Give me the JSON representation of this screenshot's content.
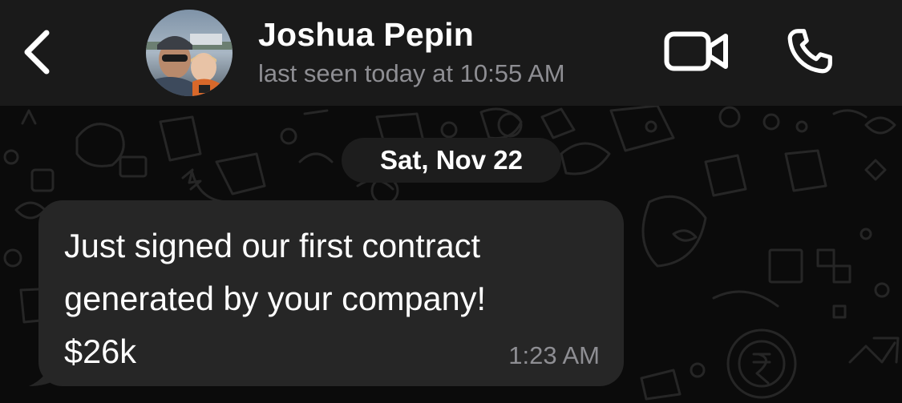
{
  "header": {
    "back_icon": "chevron-left-icon",
    "contact_name": "Joshua Pepin",
    "last_seen": "last seen today at 10:55 AM",
    "video_icon": "video-camera-icon",
    "call_icon": "phone-icon"
  },
  "chat": {
    "date_label": "Sat, Nov 22",
    "messages": [
      {
        "direction": "incoming",
        "text": "Just signed our first contract\ngenerated by your company!\n$26k",
        "time": "1:23 AM"
      }
    ]
  },
  "colors": {
    "header_bg": "#1a1a1a",
    "chat_bg": "#0b0b0b",
    "bubble_bg": "#262626",
    "secondary_text": "#8e8e93",
    "icon_color": "#ffffff"
  }
}
